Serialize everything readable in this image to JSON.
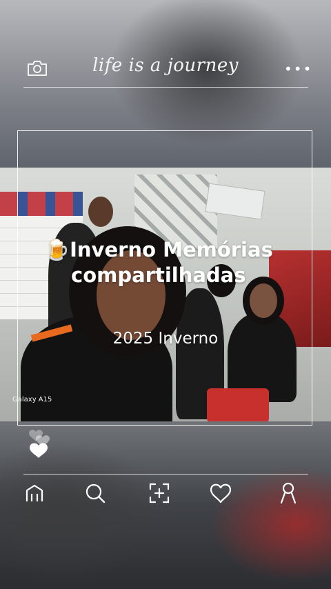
{
  "header": {
    "title": "life is a journey",
    "camera_icon": "camera-icon",
    "more_icon": "more-icon",
    "more_label": "•••"
  },
  "post": {
    "caption_line1": "Inverno Memórias",
    "caption_line2": "compartilhadas",
    "caption_emoji": "🍺",
    "subtitle": "2025 Inverno",
    "device_watermark": "Galaxy A15"
  },
  "reactions": {
    "like_icon": "heart-icon"
  },
  "nav": {
    "items": [
      {
        "name": "nav-home",
        "icon": "home-icon"
      },
      {
        "name": "nav-search",
        "icon": "search-icon"
      },
      {
        "name": "nav-add",
        "icon": "add-photo-icon"
      },
      {
        "name": "nav-likes",
        "icon": "heart-icon"
      },
      {
        "name": "nav-profile",
        "icon": "profile-icon"
      }
    ]
  },
  "colors": {
    "line": "#ffffff",
    "text": "#ffffff"
  }
}
